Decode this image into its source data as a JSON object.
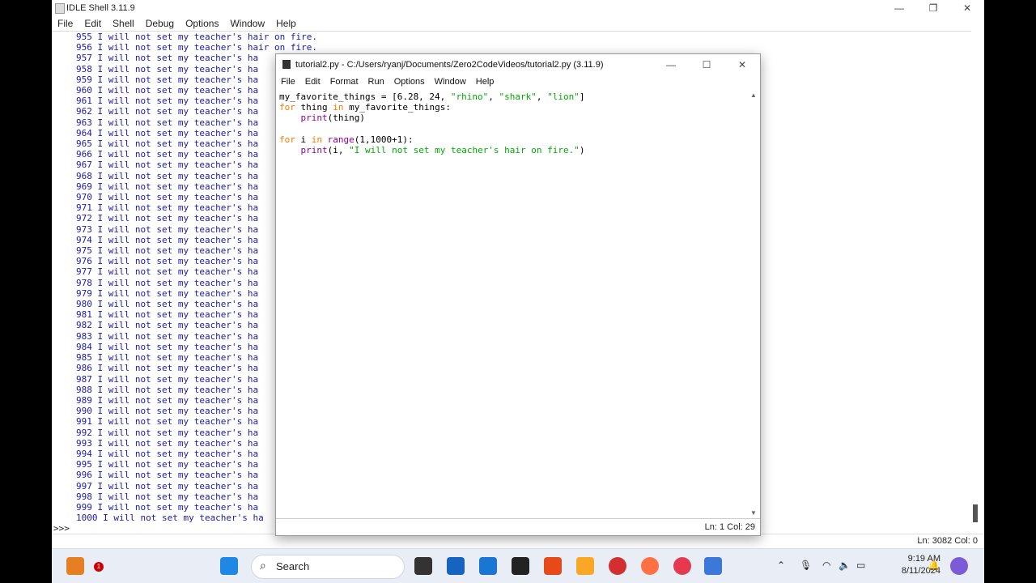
{
  "shell": {
    "title": "IDLE Shell 3.11.9",
    "menu": [
      "File",
      "Edit",
      "Shell",
      "Debug",
      "Options",
      "Window",
      "Help"
    ],
    "output_prefix_text": " I will not set my teacher's",
    "prompt": ">>>",
    "status": "Ln: 3082  Col: 0",
    "output_lines": [
      "955 I will not set my teacher's hair on fire.",
      "956 I will not set my teacher's hair on fire.",
      "957 I will not set my teacher's ha",
      "958 I will not set my teacher's ha",
      "959 I will not set my teacher's ha",
      "960 I will not set my teacher's ha",
      "961 I will not set my teacher's ha",
      "962 I will not set my teacher's ha",
      "963 I will not set my teacher's ha",
      "964 I will not set my teacher's ha",
      "965 I will not set my teacher's ha",
      "966 I will not set my teacher's ha",
      "967 I will not set my teacher's ha",
      "968 I will not set my teacher's ha",
      "969 I will not set my teacher's ha",
      "970 I will not set my teacher's ha",
      "971 I will not set my teacher's ha",
      "972 I will not set my teacher's ha",
      "973 I will not set my teacher's ha",
      "974 I will not set my teacher's ha",
      "975 I will not set my teacher's ha",
      "976 I will not set my teacher's ha",
      "977 I will not set my teacher's ha",
      "978 I will not set my teacher's ha",
      "979 I will not set my teacher's ha",
      "980 I will not set my teacher's ha",
      "981 I will not set my teacher's ha",
      "982 I will not set my teacher's ha",
      "983 I will not set my teacher's ha",
      "984 I will not set my teacher's ha",
      "985 I will not set my teacher's ha",
      "986 I will not set my teacher's ha",
      "987 I will not set my teacher's ha",
      "988 I will not set my teacher's ha",
      "989 I will not set my teacher's ha",
      "990 I will not set my teacher's ha",
      "991 I will not set my teacher's ha",
      "992 I will not set my teacher's ha",
      "993 I will not set my teacher's ha",
      "994 I will not set my teacher's ha",
      "995 I will not set my teacher's ha",
      "996 I will not set my teacher's ha",
      "997 I will not set my teacher's ha",
      "998 I will not set my teacher's ha",
      "999 I will not set my teacher's ha",
      "1000 I will not set my teacher's ha"
    ]
  },
  "editor": {
    "title": "tutorial2.py - C:/Users/ryanj/Documents/Zero2CodeVideos/tutorial2.py (3.11.9)",
    "menu": [
      "File",
      "Edit",
      "Format",
      "Run",
      "Options",
      "Window",
      "Help"
    ],
    "code": {
      "line1_a": "my_favorite_things = [6.28, 24, ",
      "line1_s1": "\"rhino\"",
      "line1_sep1": ", ",
      "line1_s2": "\"shark\"",
      "line1_sep2": ", ",
      "line1_s3": "\"lion\"",
      "line1_end": "]",
      "line2_kw1": "for",
      "line2_mid": " thing ",
      "line2_kw2": "in",
      "line2_end": " my_favorite_things:",
      "line3_indent": "    ",
      "line3_bi": "print",
      "line3_end": "(thing)",
      "line5_kw1": "for",
      "line5_mid": " i ",
      "line5_kw2": "in",
      "line5_sp": " ",
      "line5_bi": "range",
      "line5_end": "(1,1000+1):",
      "line6_indent": "    ",
      "line6_bi": "print",
      "line6_a": "(i, ",
      "line6_str": "\"I will not set my teacher's hair on fire.\"",
      "line6_end": ")"
    },
    "status": "Ln: 1    Col: 29"
  },
  "taskbar": {
    "search_label": "Search",
    "time": "9:19 AM",
    "date": "8/11/2024",
    "notification_badge": "1",
    "icons": [
      "start-icon",
      "search-icon",
      "file-explorer-icon",
      "microsoft-store-icon",
      "vscode-icon",
      "terminal-icon",
      "brave-icon",
      "folder-icon",
      "opera-icon",
      "firefox-icon",
      "screen-recorder-icon",
      "python-idle-icon"
    ]
  },
  "colors": {
    "shell_output": "#1a1aa8",
    "keyword": "#ff7700",
    "builtin": "#900090",
    "string": "#00aa00"
  }
}
